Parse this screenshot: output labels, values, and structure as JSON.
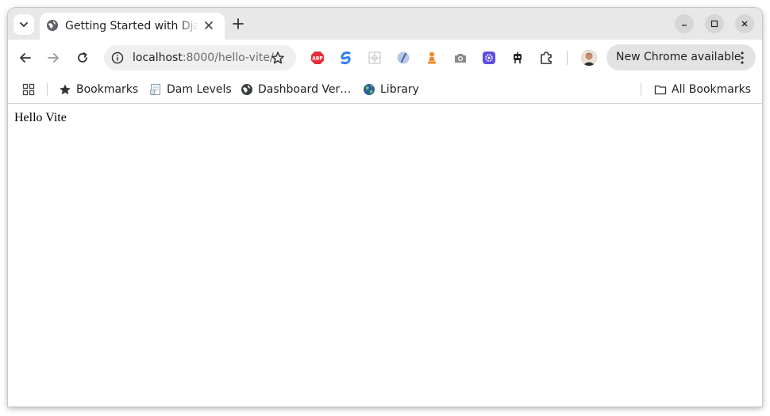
{
  "tab": {
    "title": "Getting Started with Django and Vite",
    "favicon": "globe-icon"
  },
  "toolbar": {
    "url_host": "localhost",
    "url_path": ":8000/hello-vite/",
    "update_label": "New Chrome available",
    "extensions": [
      "adblock-plus-icon",
      "blue-swirl-icon",
      "grid-ext-icon",
      "lens-ext-icon",
      "chess-pawn-icon",
      "camera-icon",
      "gear-badge-icon",
      "robot-icon",
      "puzzle-icon"
    ]
  },
  "bookmarks": {
    "items": [
      {
        "label": "Bookmarks",
        "icon": "star-icon"
      },
      {
        "label": "Dam Levels",
        "icon": "document-icon"
      },
      {
        "label": "Dashboard Ver…",
        "icon": "globe-icon"
      },
      {
        "label": "Library",
        "icon": "earth-icon"
      }
    ],
    "all_label": "All Bookmarks"
  },
  "page": {
    "body_text": "Hello Vite"
  },
  "colors": {
    "titlebar": "#e8e8e8",
    "omnibox": "#efefef",
    "update_pill": "#e3e3e3",
    "abp_red": "#e0313b",
    "accent_blue": "#1a73e8"
  }
}
